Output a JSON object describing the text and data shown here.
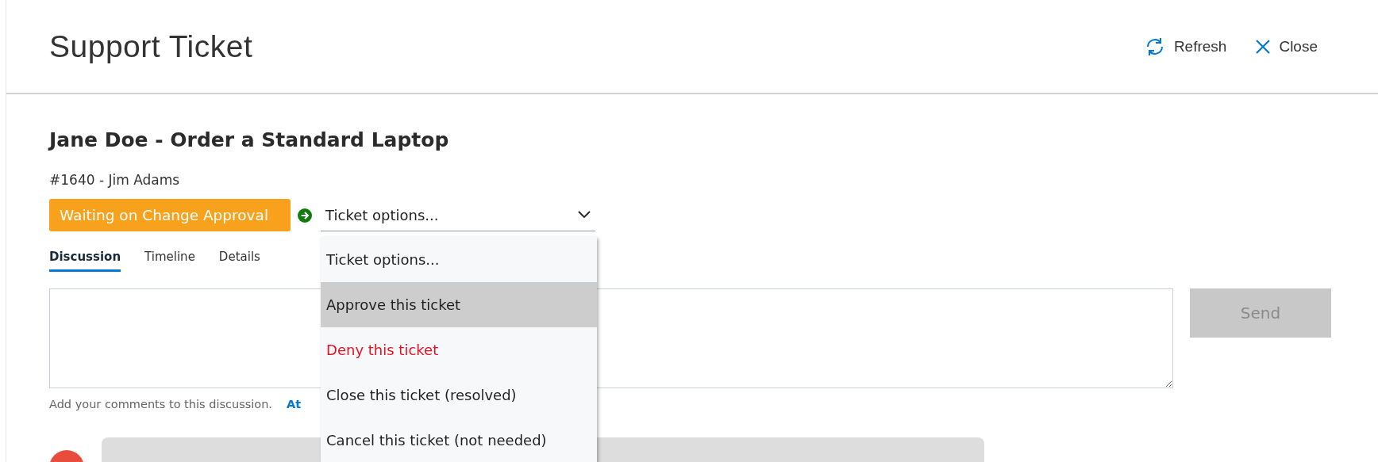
{
  "header": {
    "title": "Support Ticket",
    "actions": [
      {
        "kind": "refresh",
        "label": "Refresh"
      },
      {
        "kind": "close",
        "label": "Close"
      }
    ]
  },
  "ticket": {
    "title": "Jane Doe - Order a Standard Laptop",
    "subtitle": "#1640 - Jim Adams",
    "status": "Waiting on Change Approval"
  },
  "options_select": {
    "value": "Ticket options...",
    "expanded": true,
    "items": [
      {
        "label": "Ticket options...",
        "highlighted": false,
        "color": "#1f1f1f"
      },
      {
        "label": "Approve this ticket",
        "highlighted": true,
        "color": "#1f1f1f"
      },
      {
        "label": "Deny this ticket",
        "highlighted": false,
        "color": "#e81123"
      },
      {
        "label": "Close this ticket (resolved)",
        "highlighted": false,
        "color": "#1f1f1f"
      },
      {
        "label": "Cancel this ticket (not needed)",
        "highlighted": false,
        "color": "#1f1f1f"
      }
    ]
  },
  "tabs": [
    {
      "label": "Discussion",
      "selected": true
    },
    {
      "label": "Timeline",
      "selected": false
    },
    {
      "label": "Details",
      "selected": false
    }
  ],
  "comment": {
    "send_label": "Send",
    "send_disabled": true,
    "hint": "Add your comments to this discussion.",
    "link": "At"
  }
}
